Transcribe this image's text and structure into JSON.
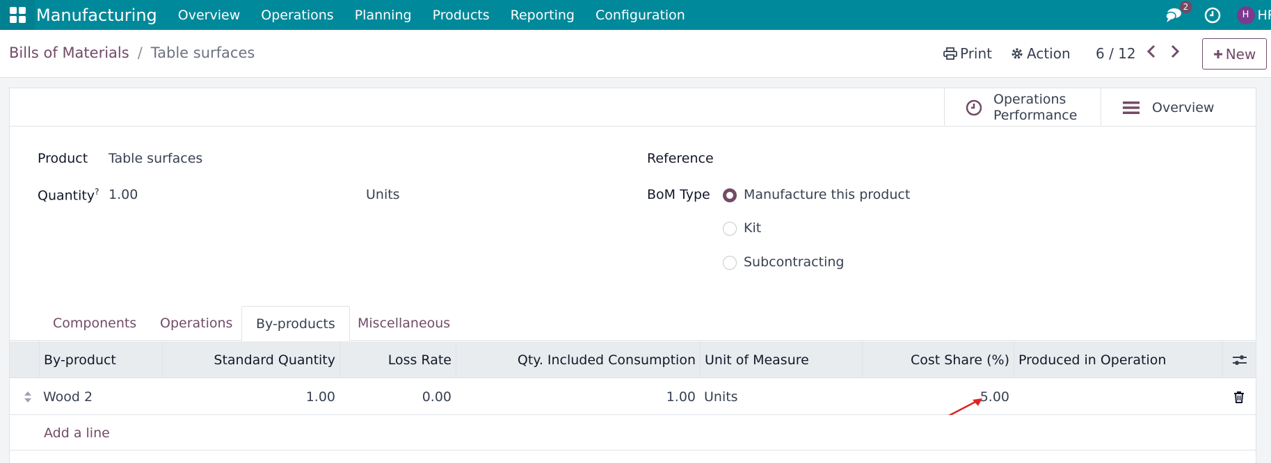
{
  "navbar": {
    "app_name": "Manufacturing",
    "menu": [
      "Overview",
      "Operations",
      "Planning",
      "Products",
      "Reporting",
      "Configuration"
    ],
    "messages_badge": "2",
    "avatar_initial": "H",
    "user_label": "HR",
    "bg_color": "#00899a"
  },
  "control_panel": {
    "breadcrumb_parent": "Bills of Materials",
    "breadcrumb_separator": "/",
    "breadcrumb_current": "Table surfaces",
    "print_label": "Print",
    "action_label": "Action",
    "pager": "6 / 12",
    "new_label": "New"
  },
  "stat_buttons": {
    "operations_performance_line1": "Operations",
    "operations_performance_line2": "Performance",
    "overview": "Overview"
  },
  "form": {
    "product_label": "Product",
    "product_value": "Table surfaces",
    "quantity_label": "Quantity",
    "quantity_help": "?",
    "quantity_value": "1.00",
    "uom_value": "Units",
    "reference_label": "Reference",
    "bom_type_label": "BoM Type",
    "bom_type_options": [
      {
        "label": "Manufacture this product",
        "checked": true
      },
      {
        "label": "Kit",
        "checked": false
      },
      {
        "label": "Subcontracting",
        "checked": false
      }
    ]
  },
  "tabs": [
    {
      "label": "Components",
      "active": false
    },
    {
      "label": "Operations",
      "active": false
    },
    {
      "label": "By-products",
      "active": true
    },
    {
      "label": "Miscellaneous",
      "active": false
    }
  ],
  "table": {
    "columns": [
      "By-product",
      "Standard Quantity",
      "Loss Rate",
      "Qty. Included Consumption",
      "Unit of Measure",
      "Cost Share (%)",
      "Produced in Operation"
    ],
    "rows": [
      {
        "by_product": "Wood 2",
        "standard_quantity": "1.00",
        "loss_rate": "0.00",
        "qty_included": "1.00",
        "uom": "Units",
        "cost_share": "5.00",
        "operation": ""
      }
    ],
    "add_line": "Add a line"
  },
  "colors": {
    "accent": "#714b67",
    "annotation_arrow": "#e02424"
  }
}
